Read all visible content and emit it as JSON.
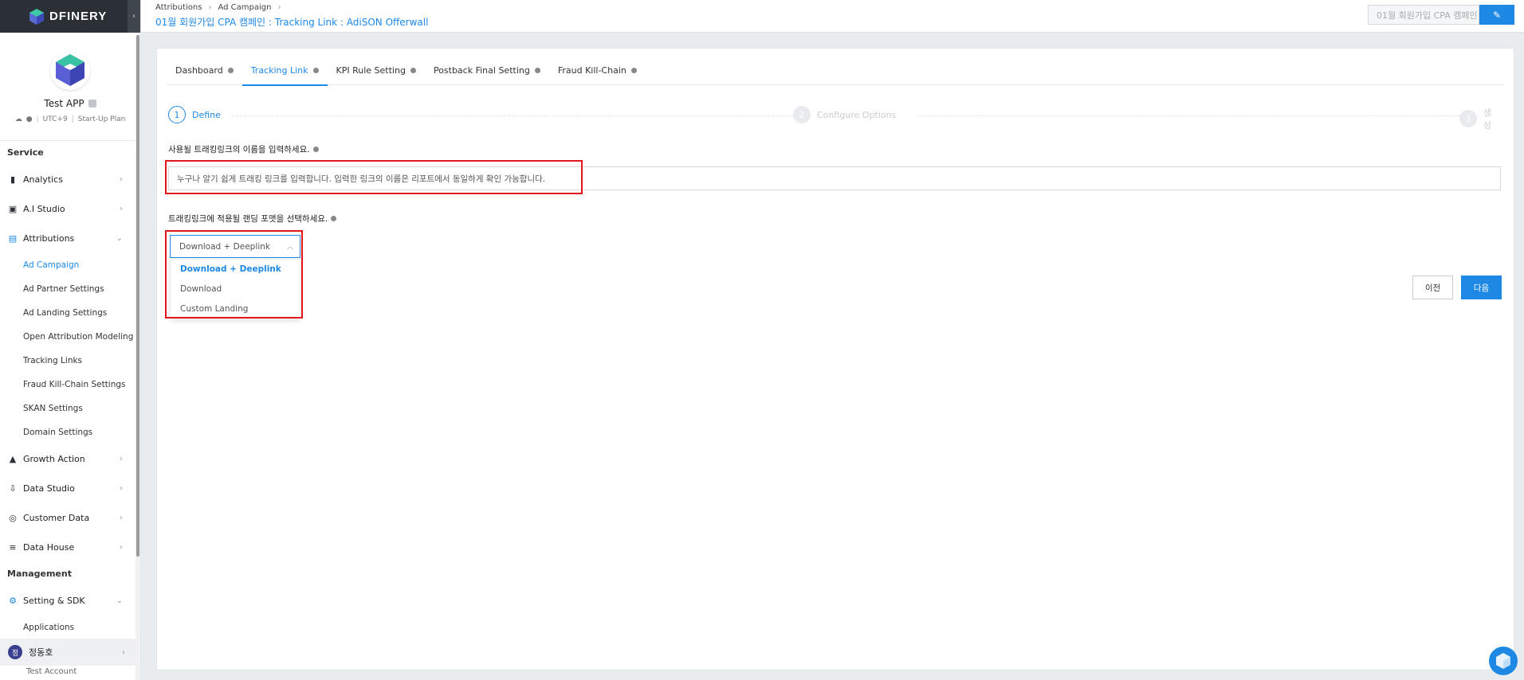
{
  "app": {
    "brand": "DFINERY",
    "collapse_icon": "chevron-left-icon"
  },
  "profile": {
    "app_name": "Test APP",
    "timezone": "UTC+9",
    "plan": "Start-Up Plan",
    "platforms": [
      "android-icon",
      "apple-icon"
    ]
  },
  "sidebar": {
    "service_title": "Service",
    "items": [
      {
        "label": "Analytics",
        "icon": "bar-chart-icon",
        "glyph": "▮"
      },
      {
        "label": "A.I Studio",
        "icon": "ai-icon",
        "glyph": "▣"
      },
      {
        "label": "Attributions",
        "icon": "attribution-icon",
        "glyph": "▤"
      }
    ],
    "attribution_subitems": [
      "Ad Campaign",
      "Ad Partner Settings",
      "Ad Landing Settings",
      "Open Attribution Modeling",
      "Tracking Links",
      "Fraud Kill-Chain Settings",
      "SKAN Settings",
      "Domain Settings"
    ],
    "more_items": [
      {
        "label": "Growth Action",
        "icon": "growth-icon",
        "glyph": "▲"
      },
      {
        "label": "Data Studio",
        "icon": "download-icon",
        "glyph": "⇩"
      },
      {
        "label": "Customer Data",
        "icon": "target-icon",
        "glyph": "◎"
      },
      {
        "label": "Data House",
        "icon": "database-icon",
        "glyph": "≡"
      }
    ],
    "management_title": "Management",
    "setting_item": {
      "label": "Setting & SDK",
      "icon": "gear-icon",
      "glyph": "⚙"
    },
    "setting_subitem": "Applications",
    "user": {
      "avatar": "정",
      "name": "정동호",
      "account": "Test Account"
    }
  },
  "header": {
    "breadcrumb": [
      "Attributions",
      "Ad Campaign"
    ],
    "title": "01월 회원가입 CPA 캠페인 : Tracking Link : AdiSON Offerwall",
    "name_field_value": "01월 회원가입 CPA 캠페인",
    "edit_icon": "pencil-icon"
  },
  "tabs": [
    {
      "label": "Dashboard",
      "active": false
    },
    {
      "label": "Tracking Link",
      "active": true
    },
    {
      "label": "KPI Rule Setting",
      "active": false
    },
    {
      "label": "Postback Final Setting",
      "active": false
    },
    {
      "label": "Fraud Kill-Chain",
      "active": false
    }
  ],
  "stepper": {
    "steps": [
      {
        "num": "1",
        "label": "Define",
        "state": "active"
      },
      {
        "num": "2",
        "label": "Configure Options",
        "state": "inactive"
      },
      {
        "num": "3",
        "label": "생성",
        "state": "inactive"
      }
    ]
  },
  "form": {
    "name_label": "사용될 트래킹링크의 이름을 입력하세요.",
    "name_placeholder": "누구나 알기 쉽게 트래킹 링크를 입력합니다. 입력한 링크의 이름은 리포트에서 동일하게 확인 가능합니다.",
    "landing_label": "트래킹링크에 적용될 랜딩 포맷을 선택하세요.",
    "landing_selected": "Download + Deeplink",
    "landing_options": [
      "Download + Deeplink",
      "Download",
      "Custom Landing"
    ],
    "prev_label": "이전",
    "next_label": "다음"
  },
  "colors": {
    "accent": "#1e88e5",
    "highlight": "#e3141c",
    "logo_bar": "#2b3036"
  }
}
